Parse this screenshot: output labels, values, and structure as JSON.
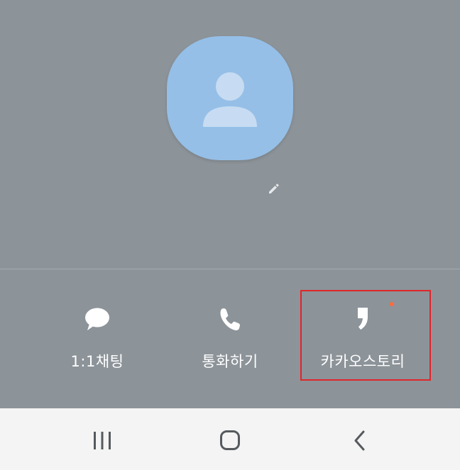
{
  "profile": {
    "avatar_icon": "person-icon",
    "edit_icon": "pencil-icon"
  },
  "actions": [
    {
      "label": "1:1채팅",
      "icon": "speech-bubble-icon"
    },
    {
      "label": "통화하기",
      "icon": "phone-icon"
    },
    {
      "label": "카카오스토리",
      "icon": "kakaostory-icon",
      "has_new_badge": true
    }
  ],
  "navbar": {
    "recent_icon": "recent-apps-icon",
    "home_icon": "home-icon",
    "back_icon": "back-icon"
  },
  "colors": {
    "background": "#8c9399",
    "avatar": "#95bfe7",
    "highlight": "#e0262a",
    "badge": "#ff6a3d",
    "navbar": "#f4f4f4"
  }
}
